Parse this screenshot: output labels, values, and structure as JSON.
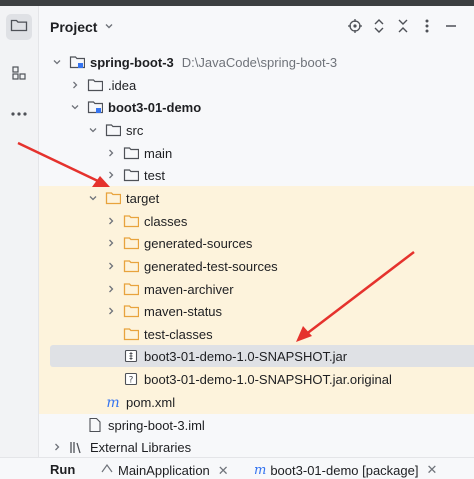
{
  "stripe": {
    "items": [
      {
        "icon": "folder-icon"
      },
      {
        "icon": "structure-icon"
      },
      {
        "icon": "more-icon"
      }
    ]
  },
  "header": {
    "title": "Project"
  },
  "tree": {
    "root": {
      "label": "spring-boot-3",
      "path": "D:\\JavaCode\\spring-boot-3"
    },
    "idea": "idea",
    "module": "boot3-01-demo",
    "src": "src",
    "main": "main",
    "test": "test",
    "target": "target",
    "classes": "classes",
    "generated_sources": "generated-sources",
    "generated_test_sources": "generated-test-sources",
    "maven_archiver": "maven-archiver",
    "maven_status": "maven-status",
    "test_classes": "test-classes",
    "jar": "boot3-01-demo-1.0-SNAPSHOT.jar",
    "jar_original": "boot3-01-demo-1.0-SNAPSHOT.jar.original",
    "pom": "pom.xml",
    "iml": "spring-boot-3.iml",
    "external": "External Libraries"
  },
  "bottom": {
    "run_label": "Run",
    "tabs": [
      {
        "label": "MainApplication"
      },
      {
        "label": "boot3-01-demo [package]"
      }
    ]
  },
  "colors": {
    "highlight": "#fdf3dc",
    "selection": "#dfe1e5",
    "folder": "#e8a33d",
    "arrow": "#e5322d"
  }
}
